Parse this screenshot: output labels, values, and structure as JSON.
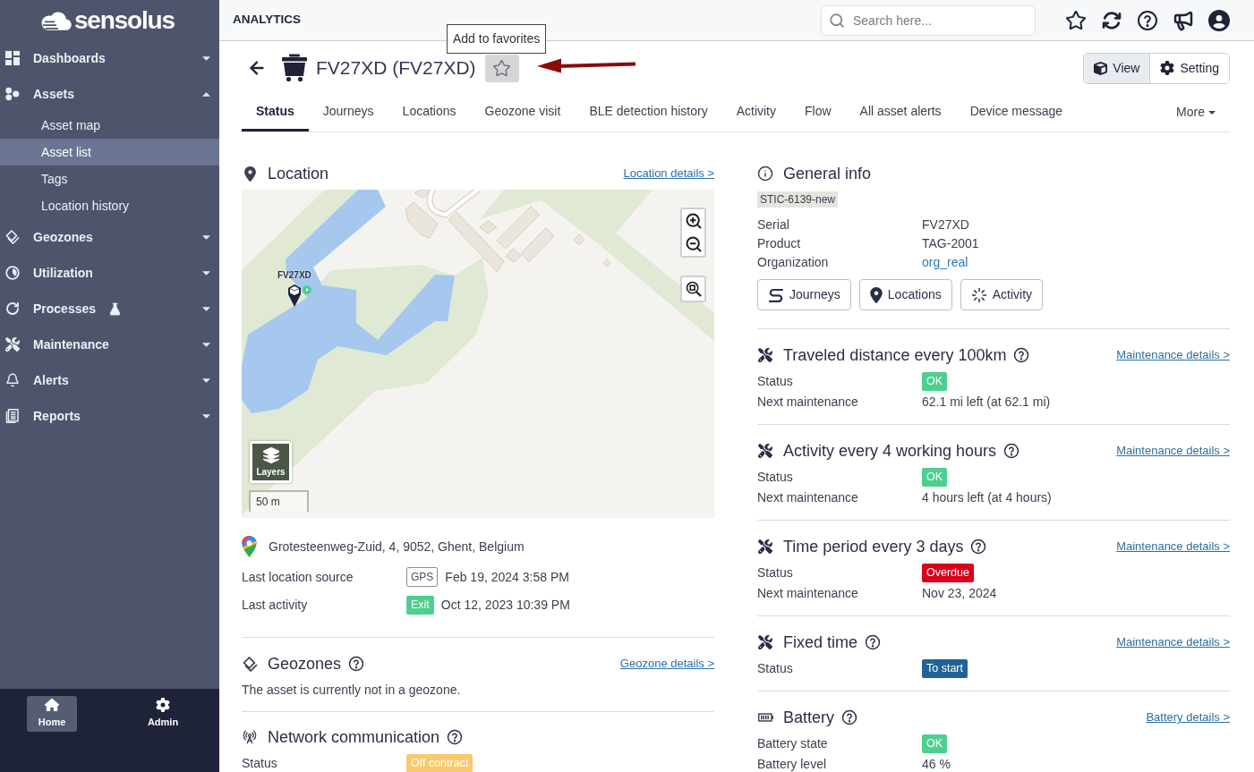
{
  "sidebar": {
    "logo": "sensolus",
    "items": [
      {
        "label": "Dashboards",
        "expanded": false
      },
      {
        "label": "Assets",
        "expanded": true,
        "children": [
          {
            "label": "Asset map",
            "selected": false
          },
          {
            "label": "Asset list",
            "selected": true
          },
          {
            "label": "Tags",
            "selected": false
          },
          {
            "label": "Location history",
            "selected": false
          }
        ]
      },
      {
        "label": "Geozones",
        "expanded": false
      },
      {
        "label": "Utilization",
        "expanded": false
      },
      {
        "label": "Processes",
        "expanded": false
      },
      {
        "label": "Maintenance",
        "expanded": false
      },
      {
        "label": "Alerts",
        "expanded": false
      },
      {
        "label": "Reports",
        "expanded": false
      }
    ]
  },
  "bottom_nav": [
    {
      "label": "Home",
      "selected": true
    },
    {
      "label": "Admin",
      "selected": false
    }
  ],
  "header": {
    "section": "ANALYTICS",
    "search": {
      "placeholder": "Search here..."
    }
  },
  "tooltip": "Add to favorites",
  "asset": {
    "title": "FV27XD (FV27XD)",
    "favorite": false,
    "view_modes": [
      {
        "label": "View",
        "selected": true
      },
      {
        "label": "Setting",
        "selected": false
      }
    ]
  },
  "tabs": [
    {
      "label": "Status",
      "selected": true
    },
    {
      "label": "Journeys",
      "selected": false
    },
    {
      "label": "Locations",
      "selected": false
    },
    {
      "label": "Geozone visit",
      "selected": false
    },
    {
      "label": "BLE detection history",
      "selected": false
    },
    {
      "label": "Activity",
      "selected": false
    },
    {
      "label": "Flow",
      "selected": false
    },
    {
      "label": "All asset alerts",
      "selected": false
    },
    {
      "label": "Device message",
      "selected": false
    }
  ],
  "more_tab": "More",
  "location": {
    "title": "Location",
    "link": "Location details >",
    "map": {
      "marker_label": "FV27XD",
      "layers": "Layers",
      "scale": "50 m"
    },
    "address": "Grotesteenweg-Zuid, 4, 9052, Ghent, Belgium",
    "rows": [
      {
        "label": "Last location source",
        "badge": {
          "kind": "outline",
          "text": "GPS"
        },
        "value": "Feb 19, 2024 3:58 PM"
      },
      {
        "label": "Last activity",
        "badge": {
          "kind": "filled",
          "text": "Exit",
          "color": "#4dcf90"
        },
        "value": "Oct 12, 2023 10:39 PM"
      }
    ]
  },
  "geozones": {
    "title": "Geozones",
    "link": "Geozone details >",
    "text": "The asset is currently not in a geozone."
  },
  "network": {
    "title": "Network communication",
    "rows": [
      {
        "label": "Status",
        "badge": {
          "kind": "filled",
          "text": "Off contract",
          "color": "#f9c96d"
        }
      }
    ]
  },
  "general_info": {
    "title": "General info",
    "tag": "STIC-6139-new",
    "fields": [
      {
        "label": "Serial",
        "value": "FV27XD",
        "kind": "text"
      },
      {
        "label": "Product",
        "value": "TAG-2001",
        "kind": "text"
      },
      {
        "label": "Organization",
        "value": "org_real",
        "kind": "link"
      }
    ],
    "buttons": [
      "Journeys",
      "Locations",
      "Activity"
    ]
  },
  "sections": [
    {
      "kind": "maintenance",
      "title": "Traveled distance every 100km",
      "link": "Maintenance details >",
      "rows": [
        {
          "label": "Status",
          "badge": {
            "kind": "filled",
            "text": "OK",
            "color": "#4dcf90"
          }
        },
        {
          "label": "Next maintenance",
          "value": "62.1 mi left (at 62.1 mi)"
        }
      ]
    },
    {
      "kind": "maintenance",
      "title": "Activity every 4 working hours",
      "link": "Maintenance details >",
      "rows": [
        {
          "label": "Status",
          "badge": {
            "kind": "filled",
            "text": "OK",
            "color": "#4dcf90"
          }
        },
        {
          "label": "Next maintenance",
          "value": "4 hours left (at 4 hours)"
        }
      ]
    },
    {
      "kind": "maintenance",
      "title": "Time period every 3 days",
      "link": "Maintenance details >",
      "rows": [
        {
          "label": "Status",
          "badge": {
            "kind": "filled",
            "text": "Overdue",
            "color": "#d9001b"
          }
        },
        {
          "label": "Next maintenance",
          "value": "Nov 23, 2024"
        }
      ]
    },
    {
      "kind": "maintenance",
      "title": "Fixed time",
      "link": "Maintenance details >",
      "rows": [
        {
          "label": "Status",
          "badge": {
            "kind": "filled",
            "text": "To start",
            "color": "#1f6398"
          }
        }
      ]
    },
    {
      "kind": "battery",
      "title": "Battery",
      "link": "Battery details >",
      "rows": [
        {
          "label": "Battery state",
          "badge": {
            "kind": "filled",
            "text": "OK",
            "color": "#4dcf90"
          }
        },
        {
          "label": "Battery level",
          "value": "46 %"
        }
      ]
    }
  ]
}
